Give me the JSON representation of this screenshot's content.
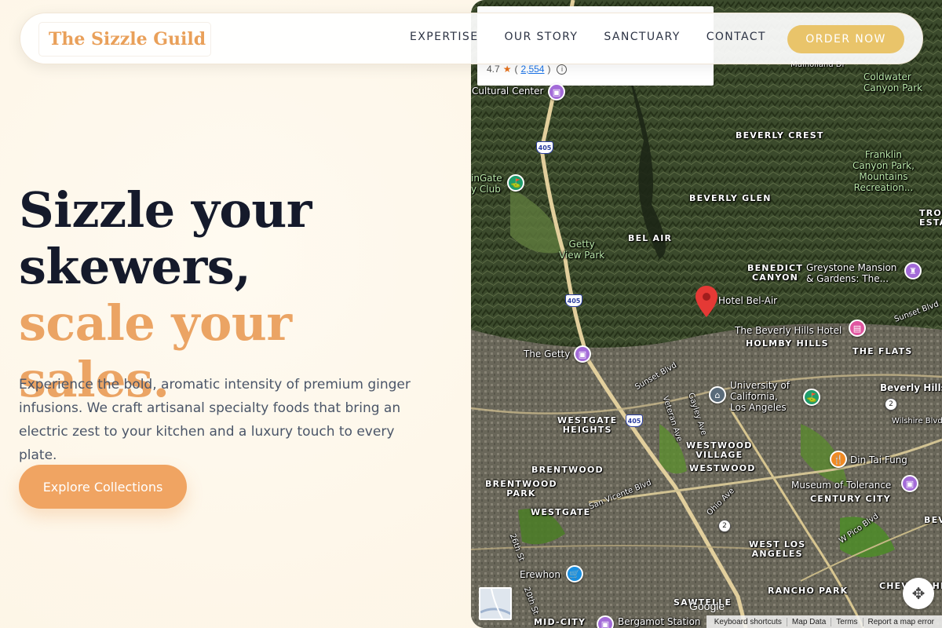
{
  "brand": {
    "name": "The Sizzle Guild"
  },
  "nav": {
    "links": [
      "EXPERTISE",
      "OUR STORY",
      "SANCTUARY",
      "CONTACT"
    ],
    "order_label": "ORDER NOW"
  },
  "hero": {
    "title_line1": "Sizzle your",
    "title_line2": "skewers,",
    "title_accent": "scale your sales.",
    "description": "Experience the bold, aromatic intensity of premium ginger infusions. We craft artisanal specialty foods that bring an electric zest to your kitchen and a luxury touch to every plate.",
    "cta_label": "Explore Collections"
  },
  "colors": {
    "accent": "#eba464",
    "order_button": "#e9c46a",
    "heading": "#151a2b",
    "body_text": "#4a5568"
  },
  "map": {
    "info_card": {
      "rating": "4.7",
      "review_count": "2,554"
    },
    "labels": {
      "cultural_center": "Cultural Center",
      "coldwater": "Coldwater\nCanyon Park",
      "beverly_crest": "BEVERLY CREST",
      "franklin": "Franklin\nCanyon Park,\nMountains\nRecreation...",
      "beverly_glen": "BEVERLY GLEN",
      "bel_air": "BEL AIR",
      "getty_view": "Getty\nView Park",
      "benedict": "BENEDICT\nCANYON",
      "greystone": "Greystone Mansion\n& Gardens: The...",
      "hotel_bel_air": "Hotel Bel-Air",
      "beverly_hills_hotel": "The Beverly Hills Hotel",
      "holmby_hills": "HOLMBY HILLS",
      "the_flats": "THE FLATS",
      "the_getty": "The Getty",
      "ucla": "University of\nCalifornia,\nLos Angeles",
      "beverly_hills": "Beverly Hills",
      "westgate_heights": "WESTGATE\nHEIGHTS",
      "westwood_village": "WESTWOOD\nVILLAGE",
      "westwood": "WESTWOOD",
      "din_tai_fung": "Din Tai Fung",
      "brentwood": "BRENTWOOD",
      "brentwood_park": "BRENTWOOD\nPARK",
      "museum_tolerance": "Museum of Tolerance",
      "century_city": "CENTURY CITY",
      "westgate": "WESTGATE",
      "west_la": "WEST LOS\nANGELES",
      "erewhon": "Erewhon",
      "rancho_park": "RANCHO PARK",
      "cheviot": "CHEVIOT HIL",
      "sawtelle": "SAWTELLE",
      "mid_city": "MID-CITY",
      "bergamot": "Bergamot Station",
      "sunset_blvd": "Sunset Blvd",
      "sunset_blvd2": "Sunset Blvd",
      "veteran_ave": "Veteran Ave",
      "gayley_ave": "Gayley Ave",
      "ohio_ave": "Ohio Ave",
      "san_vicente": "San Vicente Blvd",
      "wilshire": "Wilshire Blvd",
      "pico": "W Pico Blvd",
      "st26": "26th St",
      "st20": "20th St",
      "mulholland": "Mulholland Dr",
      "golf_club": "inGate\ny Club",
      "trousdale": "TROUS\nESTA",
      "beverl": "BEVERL"
    },
    "highway_405": "405",
    "route_2": "2",
    "google": "Google",
    "attribution": [
      "Keyboard shortcuts",
      "Map Data",
      "Terms",
      "Report a map error"
    ]
  }
}
